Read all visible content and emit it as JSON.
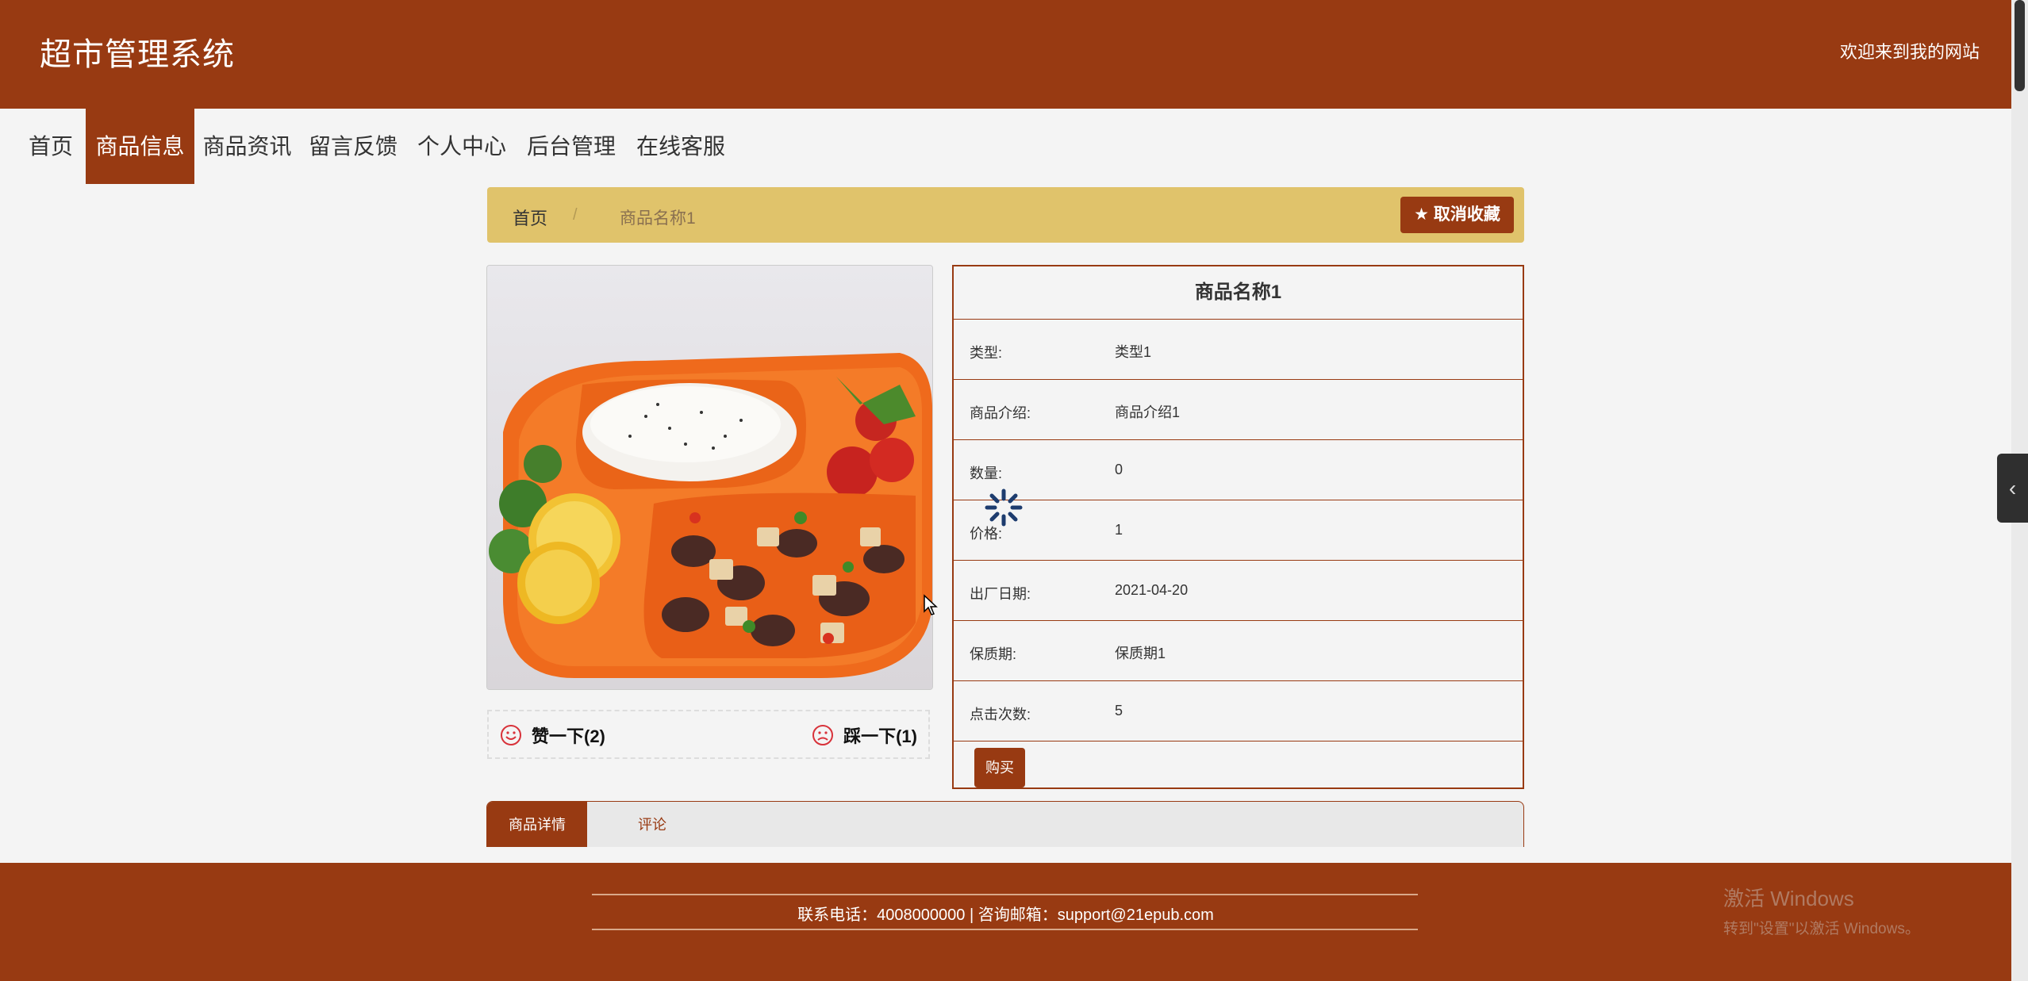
{
  "header": {
    "site_title": "超市管理系统",
    "welcome": "欢迎来到我的网站"
  },
  "nav": [
    {
      "label": "首页"
    },
    {
      "label": "商品信息",
      "active": true
    },
    {
      "label": "商品资讯"
    },
    {
      "label": "留言反馈"
    },
    {
      "label": "个人中心"
    },
    {
      "label": "后台管理"
    },
    {
      "label": "在线客服"
    }
  ],
  "breadcrumb": {
    "home": "首页",
    "separator": "/",
    "current": "商品名称1"
  },
  "favorite_button": "取消收藏",
  "votes": {
    "up": "赞一下(2)",
    "down": "踩一下(1)"
  },
  "product": {
    "name": "商品名称1",
    "fields": [
      {
        "label": "类型:",
        "value": "类型1"
      },
      {
        "label": "商品介绍:",
        "value": "商品介绍1"
      },
      {
        "label": "数量:",
        "value": "0"
      },
      {
        "label": "价格:",
        "value": "1"
      },
      {
        "label": "出厂日期:",
        "value": "2021-04-20"
      },
      {
        "label": "保质期:",
        "value": "保质期1"
      },
      {
        "label": "点击次数:",
        "value": "5"
      }
    ],
    "buy_button": "购买"
  },
  "tabs": [
    {
      "label": "商品详情",
      "active": true
    },
    {
      "label": "评论"
    }
  ],
  "footer": {
    "contact": "联系电话：4008000000 | 咨询邮箱：support@21epub.com"
  },
  "windows_watermark": {
    "title": "激活 Windows",
    "subtitle": "转到\"设置\"以激活 Windows。"
  },
  "colors": {
    "primary": "#983a12",
    "breadcrumb_bg": "#e0c36b",
    "page_bg": "#f4f4f4"
  },
  "icons": {
    "favorite": "star-icon",
    "vote_up": "smile-icon",
    "vote_down": "frown-icon",
    "loading": "spinner-icon",
    "side_tab": "chevron-left-icon"
  }
}
